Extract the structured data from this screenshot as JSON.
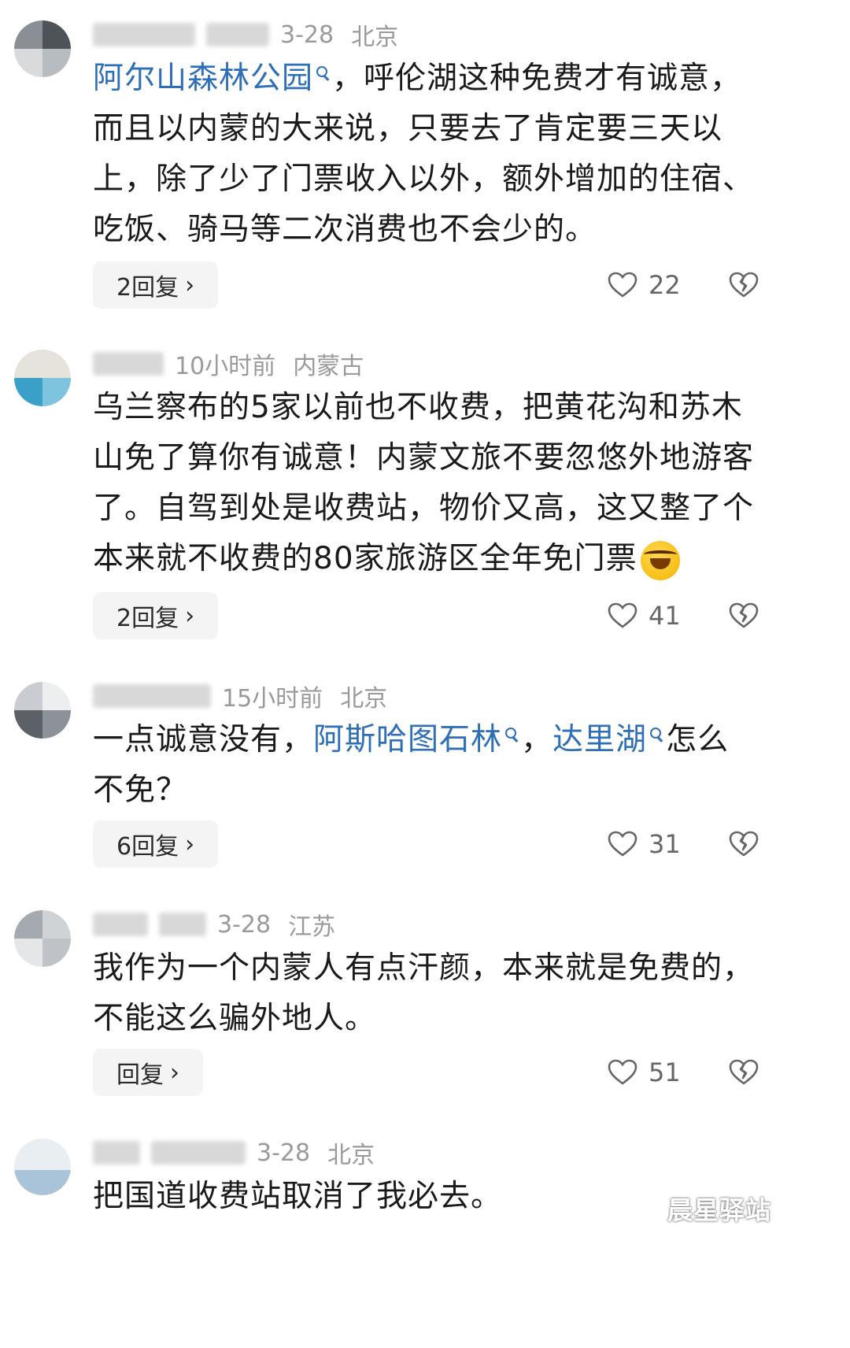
{
  "comments": [
    {
      "time": "3-28",
      "location": "北京",
      "body": [
        {
          "t": "阿尔山森林公园",
          "link": true
        },
        {
          "t": "，呼伦湖这种免费才有诚意，而且以内蒙的大来说，只要去了肯定要三天以上，除了少了门票收入以外，额外增加的住宿、吃饭、骑马等二次消费也不会少的。",
          "link": false
        }
      ],
      "reply_label": "2回复",
      "likes": "22"
    },
    {
      "time": "10小时前",
      "location": "内蒙古",
      "body": [
        {
          "t": "乌兰察布的5家以前也不收费，把黄花沟和苏木山免了算你有诚意！内蒙文旅不要忽悠外地游客了。自驾到处是收费站，物价又高，这又整了个本来就不收费的80家旅游区全年免门票",
          "link": false
        }
      ],
      "emoji": "laugh-cry-emoji",
      "reply_label": "2回复",
      "likes": "41"
    },
    {
      "time": "15小时前",
      "location": "北京",
      "body": [
        {
          "t": "一点诚意没有，",
          "link": false
        },
        {
          "t": "阿斯哈图石林",
          "link": true
        },
        {
          "t": "，",
          "link": false
        },
        {
          "t": "达里湖",
          "link": true
        },
        {
          "t": "怎么不免？",
          "link": false
        }
      ],
      "reply_label": "6回复",
      "likes": "31"
    },
    {
      "time": "3-28",
      "location": "江苏",
      "body": [
        {
          "t": "我作为一个内蒙人有点汗颜，本来就是免费的，不能这么骗外地人。",
          "link": false
        }
      ],
      "reply_label": "回复",
      "likes": "51"
    },
    {
      "time": "3-28",
      "location": "北京",
      "body": [
        {
          "t": "把国道收费站取消了我必去。",
          "link": false
        }
      ]
    }
  ],
  "watermark": "晨星驿站",
  "colors": {
    "link": "#2f6fb7",
    "meta": "#9a9a9a",
    "reply_bg": "#f4f4f4"
  }
}
